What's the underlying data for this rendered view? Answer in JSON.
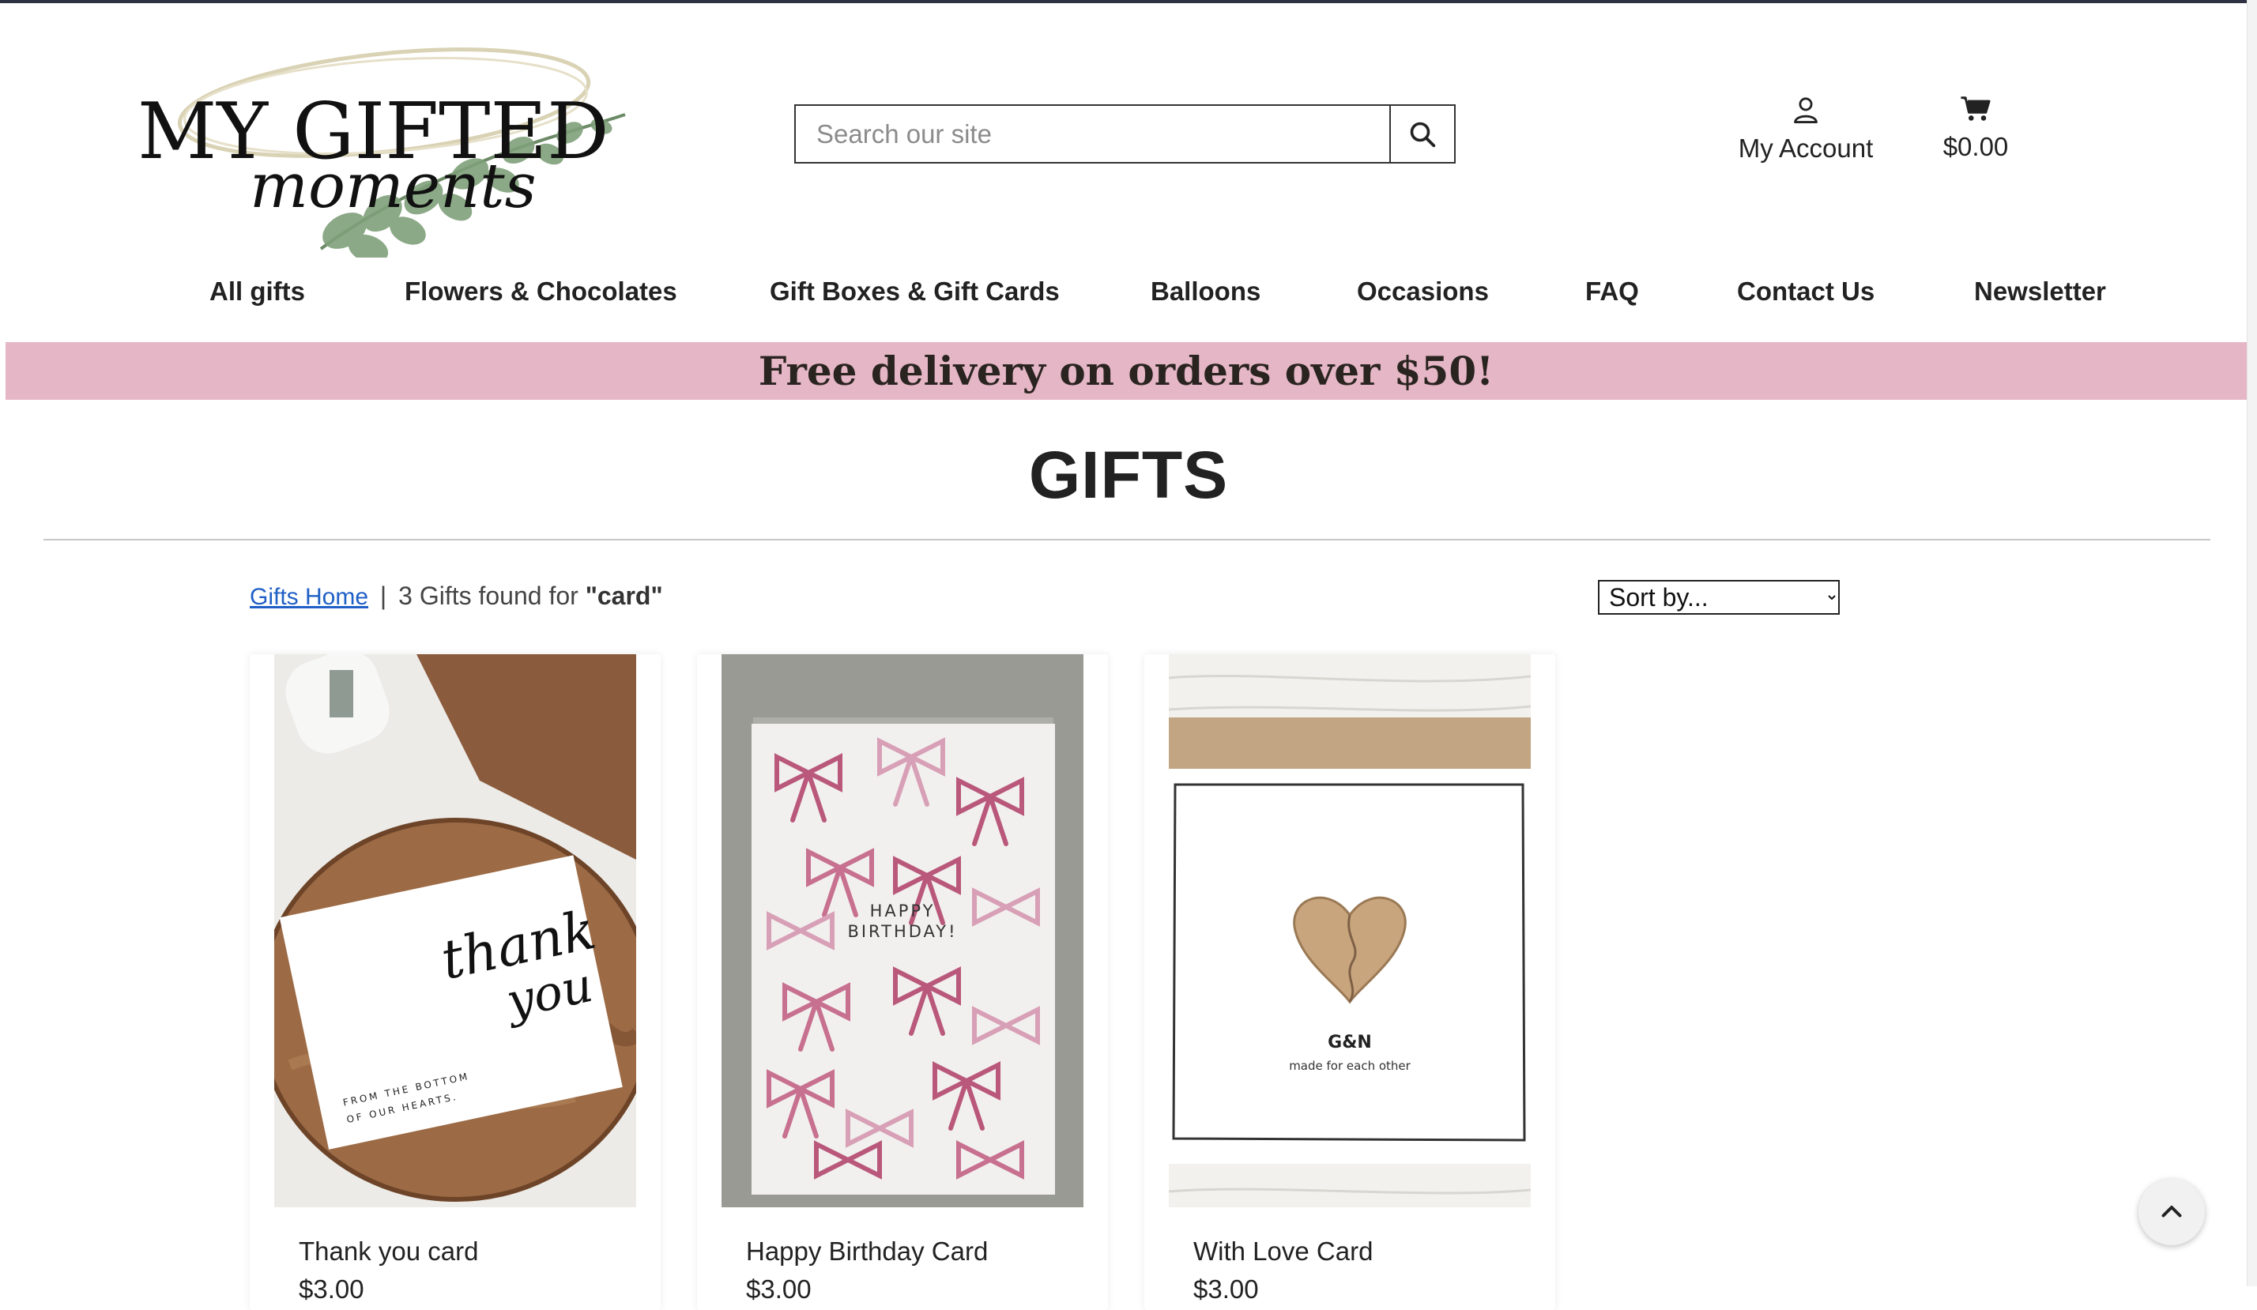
{
  "brand": {
    "logo_line1": "MY GIFTED",
    "logo_line2": "moments"
  },
  "search": {
    "placeholder": "Search our site",
    "icon": "search-icon"
  },
  "header": {
    "account_label": "My Account",
    "account_icon": "user-icon",
    "cart_total": "$0.00",
    "cart_icon": "cart-icon"
  },
  "nav": {
    "items": [
      {
        "label": "All gifts"
      },
      {
        "label": "Flowers & Chocolates"
      },
      {
        "label": "Gift Boxes & Gift Cards"
      },
      {
        "label": "Balloons"
      },
      {
        "label": "Occasions"
      },
      {
        "label": "FAQ"
      },
      {
        "label": "Contact Us"
      },
      {
        "label": "Newsletter"
      }
    ]
  },
  "banner": {
    "text": "Free delivery on orders over $50!",
    "color": "#e5b6c6"
  },
  "page": {
    "title": "GIFTS"
  },
  "breadcrumb": {
    "home_link": "Gifts Home",
    "separator": "|",
    "results_text": "3 Gifts found for",
    "query": "\"card\""
  },
  "sort": {
    "selected": "Sort by..."
  },
  "products": [
    {
      "name": "Thank you card",
      "price": "$3.00",
      "image_text": [
        "thank",
        "you",
        "FROM THE BOTTOM",
        "OF OUR HEARTS."
      ]
    },
    {
      "name": "Happy Birthday Card",
      "price": "$3.00",
      "image_text": [
        "HAPPY",
        "BIRTHDAY!"
      ]
    },
    {
      "name": "With Love Card",
      "price": "$3.00",
      "image_text": [
        "G&N",
        "made for each other"
      ]
    }
  ],
  "back_to_top": {
    "icon": "chevron-up-icon"
  }
}
